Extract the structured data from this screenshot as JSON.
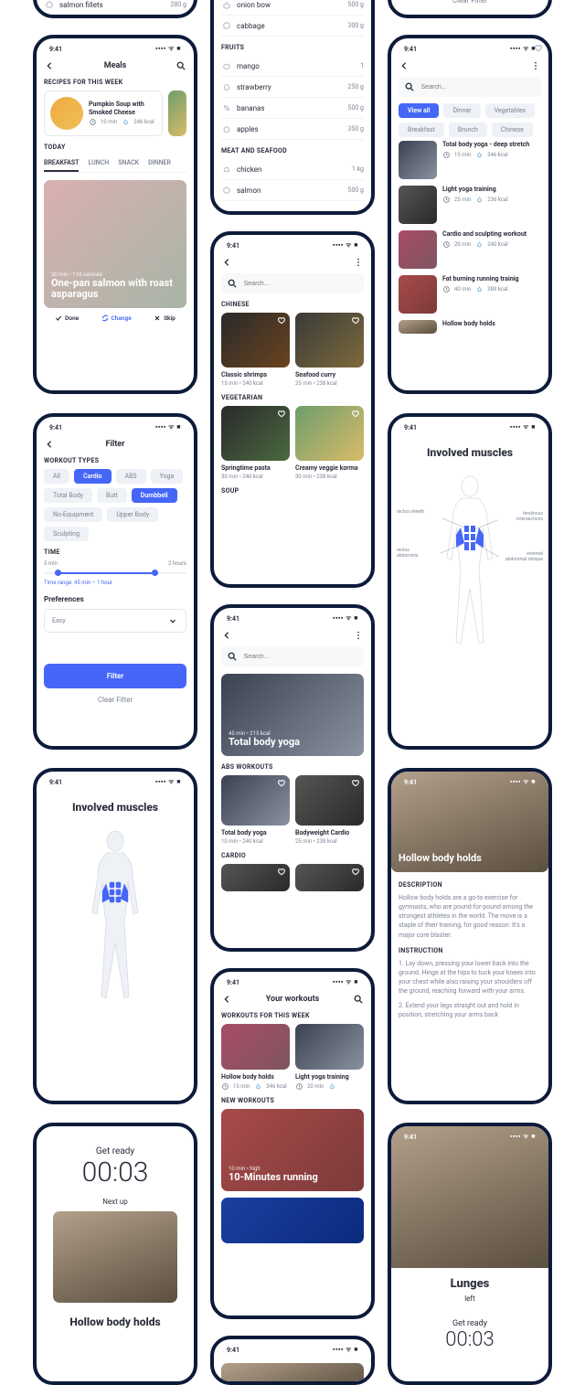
{
  "status_time": "9:41",
  "status_sig": "▪▪▪▪ ᯤ ■",
  "search_ph": "Search...",
  "clear_filter": "Clear Filter",
  "filter_btn": "Filter",
  "grocery": {
    "salmon": {
      "name": "salmon fillets",
      "amt": "280 g"
    },
    "veg": [
      {
        "name": "onion bow",
        "amt": "500 g"
      },
      {
        "name": "cabbage",
        "amt": "300 g"
      }
    ],
    "fruits_h": "FRUITS",
    "fruits": [
      {
        "name": "mango",
        "amt": "1"
      },
      {
        "name": "strawberry",
        "amt": "250 g"
      },
      {
        "name": "bananas",
        "amt": "500 g"
      },
      {
        "name": "apples",
        "amt": "350 g"
      }
    ],
    "meat_h": "MEAT AND SEAFOOD",
    "meat": [
      {
        "name": "chicken",
        "amt": "1 kg"
      },
      {
        "name": "salmon",
        "amt": "500 g"
      }
    ]
  },
  "meals": {
    "title": "Meals",
    "rec_h": "RECIPES FOR THIS WEEK",
    "recipe": {
      "name": "Pumpkin Soup with Smoked Cheese",
      "time": "10 min",
      "kcal": "246 kcal"
    },
    "today_h": "TODAY",
    "tabs": [
      "BREAKFAST",
      "LUNCH",
      "SNACK",
      "DINNER"
    ],
    "hero": {
      "sub": "30 min • 118 calories",
      "title": "One-pan salmon with roast asparagus"
    },
    "actions": {
      "done": "Done",
      "change": "Change",
      "skip": "Skip"
    }
  },
  "recipes": {
    "chinese_h": "CHINESE",
    "chinese": [
      {
        "name": "Classic shrimps",
        "meta": "15 min • 240 kcal"
      },
      {
        "name": "Seafood curry",
        "meta": "25 min • 238 kcal"
      }
    ],
    "veg_h": "VEGETARIAN",
    "veg": [
      {
        "name": "Springtime pasta",
        "meta": "30 min • 240 kcal"
      },
      {
        "name": "Creamy veggie korma",
        "meta": "30 min • 238 kcal"
      }
    ],
    "soup_h": "SOUP"
  },
  "workouts_search": {
    "pills": [
      "View all",
      "Dinner",
      "Vegetables",
      "Breakfast",
      "Brunch",
      "Chinese"
    ],
    "items": [
      {
        "name": "Total body yoga - deep stretch",
        "time": "15 min",
        "kcal": "346 kcal"
      },
      {
        "name": "Light yoga training",
        "time": "25 min",
        "kcal": "236 kcal"
      },
      {
        "name": "Cardio and sculpting workout",
        "time": "20 min",
        "kcal": "240 kcal"
      },
      {
        "name": "Fat burning running trainig",
        "time": "40 min",
        "kcal": "389 kcal"
      },
      {
        "name": "Hollow body holds"
      }
    ]
  },
  "filter": {
    "title": "Filter",
    "types_h": "WORKOUT TYPES",
    "types": [
      "All",
      "Cardio",
      "ABS",
      "Yoga",
      "Total Body",
      "Butt",
      "Dumbbell",
      "No-Equipment",
      "Upper Body",
      "Sculpting"
    ],
    "time_h": "TIME",
    "time_min": "5 min",
    "time_max": "2 hours",
    "time_range": "Time range: 45 min – 1 hour",
    "pref_h": "Preferences",
    "pref_val": "Easy"
  },
  "muscles": {
    "title": "Involved muscles",
    "labels": {
      "rs": "rectus sheeth",
      "ti": "tendinous intersections",
      "ra": "rectus abdominis",
      "eao": "external abdominal oblique"
    }
  },
  "workout_explore": {
    "hero": {
      "sub": "45 min • 215 kcal",
      "title": "Total body yoga"
    },
    "abs_h": "ABS WORKOUTS",
    "abs": [
      {
        "name": "Total body yoga",
        "meta": "10 min • 240 kcal"
      },
      {
        "name": "Bodyweight Cardio",
        "meta": "25 min • 238 kcal"
      }
    ],
    "cardio_h": "CARDIO"
  },
  "detail": {
    "title": "Hollow body holds",
    "desc_h": "DESCRIPTION",
    "desc": "Hollow body holds are a go-to exercise for gymnasts, who are pound-for-pound among the strongest athletes in the world. The move is a staple of their training, for good reason: It's a major core blaster.",
    "inst_h": "INSTRUCTION",
    "inst1": "1. Lay down, pressing your lower back into the ground. Hinge at the hips to tuck your knees into your chest while also raising your shoulders off the ground, reaching forward with your arms.",
    "inst2": "2. Extend your legs straight out and hold in position, stretching your arms back"
  },
  "your_workouts": {
    "title": "Your workouts",
    "week_h": "WORKOUTS FOR THIS WEEK",
    "week": [
      {
        "name": "Hollow body holds",
        "time": "15 min",
        "kcal": "346 kcal"
      },
      {
        "name": "Light yoga training",
        "time": "20 min",
        "kcal": ""
      }
    ],
    "new_h": "NEW WORKOUTS",
    "hero": {
      "sub": "10 min • high",
      "title": "10-Minutes running"
    }
  },
  "ready": {
    "h": "Get ready",
    "time": "00:03",
    "next": "Next up",
    "exname": "Hollow body holds"
  },
  "lunges": {
    "name": "Lunges",
    "side": "left",
    "h": "Get ready",
    "time": "00:03"
  }
}
